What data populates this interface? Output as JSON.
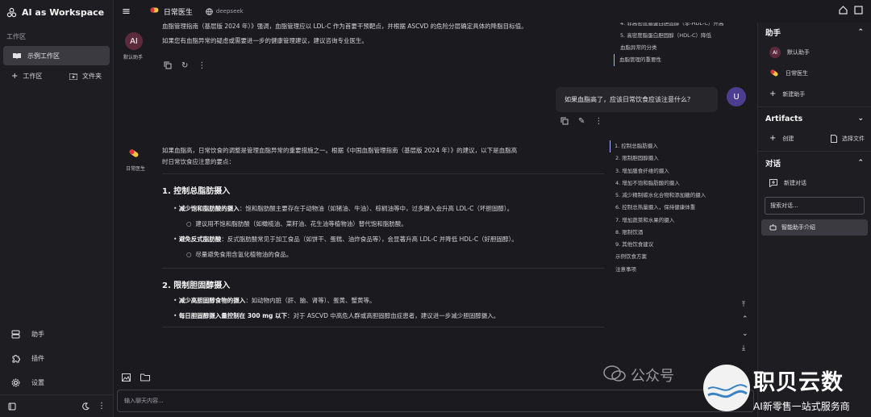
{
  "app": {
    "title": "AI as Workspace"
  },
  "left": {
    "section": "工作区",
    "workspace_item": "示例工作区",
    "add_workspace": "工作区",
    "folder": "文件夹",
    "bottom": [
      {
        "label": "助手",
        "icon": "assistant-icon"
      },
      {
        "label": "插件",
        "icon": "plugin-icon"
      },
      {
        "label": "设置",
        "icon": "gear-icon"
      }
    ]
  },
  "top": {
    "tab": "日常医生",
    "model": "deepseek"
  },
  "chat": {
    "msg1": {
      "avatar": "AI",
      "name": "默认助手",
      "line1": "血脂管理指南（基层版 2024 年）》强调，血脂管理应以 LDL-C 作为首要干预靶点，并根据 ASCVD 的危险分层确定具体的降脂目标值。",
      "line2": "如果您有血脂异常的疑虑或需要进一步的健康管理建议，建议咨询专业医生。"
    },
    "toc1": [
      "4. 非高密度脂蛋白胆固醇（非-HDL-C）升高",
      "5. 高密度脂蛋白胆固醇（HDL-C）降低",
      "血脂异常的分类",
      "血脂管理的重要性"
    ],
    "user": {
      "avatar": "U",
      "text": "如果血脂高了，应该日常饮食应该注意什么？"
    },
    "msg2": {
      "name": "日常医生",
      "intro1": "如果血脂高，日常饮食的调整是管理血脂异常的重要措施之一。根据《中国血脂管理指南（基层版 2024 年）》的建议，以下是血脂高",
      "intro2": "时日常饮食应注意的要点：",
      "s1_title": "1. 控制总脂肪摄入",
      "s1_b1_bold": "减少饱和脂肪酸的摄入",
      "s1_b1": "：饱和脂肪酸主要存在于动物油（如猪油、牛油）、棕榈油等中，过多摄入会升高 LDL-C（坏胆固醇）。",
      "s1_b1_sub": "建议用不饱和脂肪酸（如橄榄油、菜籽油、花生油等植物油）替代饱和脂肪酸。",
      "s1_b2_bold": "避免反式脂肪酸",
      "s1_b2": "：反式脂肪酸常见于加工食品（如饼干、蛋糕、油炸食品等），会显著升高 LDL-C 并降低 HDL-C（好胆固醇）。",
      "s1_b2_sub": "尽量避免食用含氢化植物油的食品。",
      "s2_title": "2. 限制胆固醇摄入",
      "s2_b1_bold": "减少高胆固醇食物的摄入",
      "s2_b1": "：如动物内脏（肝、脑、肾等）、蛋黄、蟹黄等。",
      "s2_b2_bold": "每日胆固醇摄入量控制在 300 mg 以下",
      "s2_b2": "：对于 ASCVD 中高危人群或高胆固醇血症患者，建议进一步减少胆固醇摄入。"
    },
    "toc2": [
      "1. 控制总脂肪摄入",
      "2. 限制胆固醇摄入",
      "3. 增加膳食纤维的摄入",
      "4. 增加不饱和脂肪酸的摄入",
      "5. 减少精制碳水化合物和添加糖的摄入",
      "6. 控制总热量摄入，保持健康体重",
      "7. 增加蔬菜和水果的摄入",
      "8. 限制饮酒",
      "9. 其他饮食建议",
      "示例饮食方案",
      "注意事项"
    ]
  },
  "input": {
    "placeholder": "输入聊天内容..."
  },
  "right": {
    "assist_title": "助手",
    "assistants": [
      {
        "avatar": "AI",
        "label": "默认助手"
      },
      {
        "label": "日常医生"
      }
    ],
    "new_assistant": "新建助手",
    "artifacts_title": "Artifacts",
    "create": "创建",
    "choose_file": "选择文件",
    "conv_title": "对话",
    "new_conv": "新建对话",
    "search_placeholder": "搜索对话...",
    "conv_item": "智能助手介绍"
  },
  "watermark": {
    "left": "公众号",
    "brand": "职贝云数",
    "slogan": "AI新零售一站式服务商"
  },
  "colors": {
    "bg": "#1b1b1f",
    "sidebar": "#1e1e22",
    "active": "#3a3a40",
    "user_avatar": "#4c3d8f",
    "ai_avatar": "#5c2a3a"
  }
}
